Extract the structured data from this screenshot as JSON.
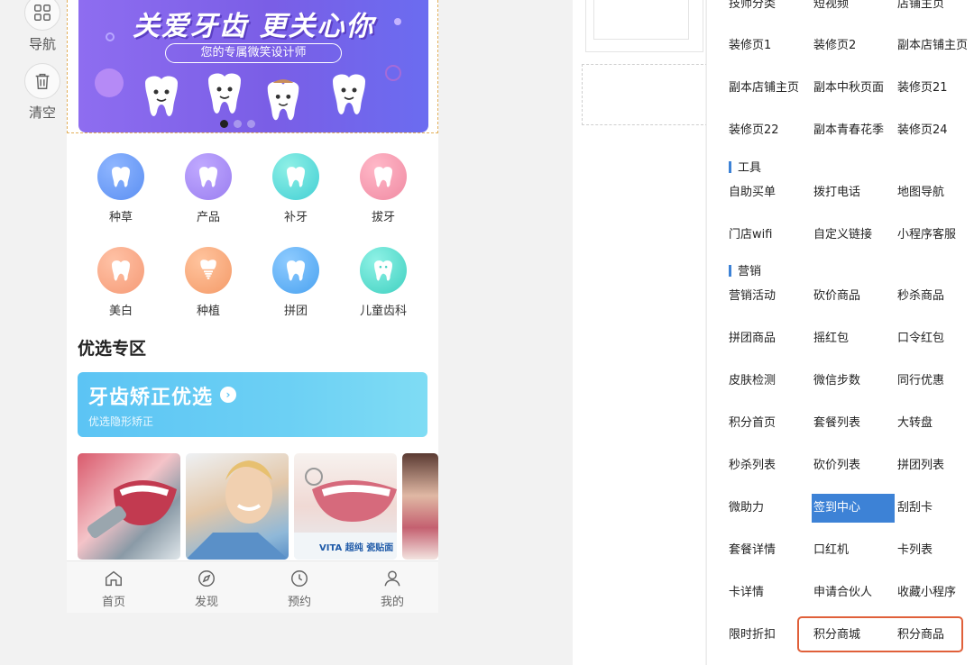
{
  "toolbar": {
    "items": [
      {
        "label": "导航",
        "icon": "grid-icon"
      },
      {
        "label": "清空",
        "icon": "trash-icon"
      }
    ]
  },
  "phone": {
    "banner": {
      "title": "关爱牙齿 更关心你",
      "subtitle": "您的专属微笑设计师",
      "carousel_pages": 3,
      "active_page": 1,
      "gradient": [
        "#8e6df0",
        "#6b6cf0"
      ]
    },
    "grid": [
      {
        "label": "种草",
        "color": "#5b8ff2"
      },
      {
        "label": "产品",
        "color": "#9a7ef0"
      },
      {
        "label": "补牙",
        "color": "#42cfd4"
      },
      {
        "label": "拔牙",
        "color": "#f08aa2"
      },
      {
        "label": "美白",
        "color": "#f59a76"
      },
      {
        "label": "种植",
        "color": "#f49a68"
      },
      {
        "label": "拼团",
        "color": "#4aa2f0"
      },
      {
        "label": "儿童齿科",
        "color": "#3fd0c0"
      }
    ],
    "section_title": "优选专区",
    "promo": {
      "title": "牙齿矫正优选",
      "subtitle": "优选隐形矫正"
    },
    "photos": [
      {
        "caption": ""
      },
      {
        "caption": ""
      },
      {
        "caption": "VITA 超纯 瓷贴面"
      },
      {
        "caption": ""
      }
    ],
    "tabs": [
      {
        "label": "首页",
        "icon": "home-icon"
      },
      {
        "label": "发现",
        "icon": "compass-icon"
      },
      {
        "label": "预约",
        "icon": "clock-icon"
      },
      {
        "label": "我的",
        "icon": "user-icon"
      }
    ]
  },
  "panel": {
    "pages": [
      [
        "技师分类",
        "短视频",
        "店铺主页"
      ],
      [
        "装修页1",
        "装修页2",
        "副本店铺主页"
      ],
      [
        "副本店铺主页",
        "副本中秋页面",
        "装修页21"
      ],
      [
        "装修页22",
        "副本青春花季",
        "装修页24"
      ]
    ],
    "tools_title": "工具",
    "tools": [
      [
        "自助买单",
        "拨打电话",
        "地图导航"
      ],
      [
        "门店wifi",
        "自定义链接",
        "小程序客服"
      ]
    ],
    "marketing_title": "营销",
    "marketing": [
      [
        "营销活动",
        "砍价商品",
        "秒杀商品"
      ],
      [
        "拼团商品",
        "摇红包",
        "口令红包"
      ],
      [
        "皮肤检测",
        "微信步数",
        "同行优惠"
      ],
      [
        "积分首页",
        "套餐列表",
        "大转盘"
      ],
      [
        "秒杀列表",
        "砍价列表",
        "拼团列表"
      ],
      [
        "微助力",
        "签到中心",
        "刮刮卡"
      ],
      [
        "套餐详情",
        "口红机",
        "卡列表"
      ],
      [
        "卡详情",
        "申请合伙人",
        "收藏小程序"
      ],
      [
        "限时折扣",
        "积分商城",
        "积分商品"
      ]
    ],
    "selected": "签到中心",
    "accent": "#3d82d6",
    "highlight_color": "#e0603a"
  }
}
